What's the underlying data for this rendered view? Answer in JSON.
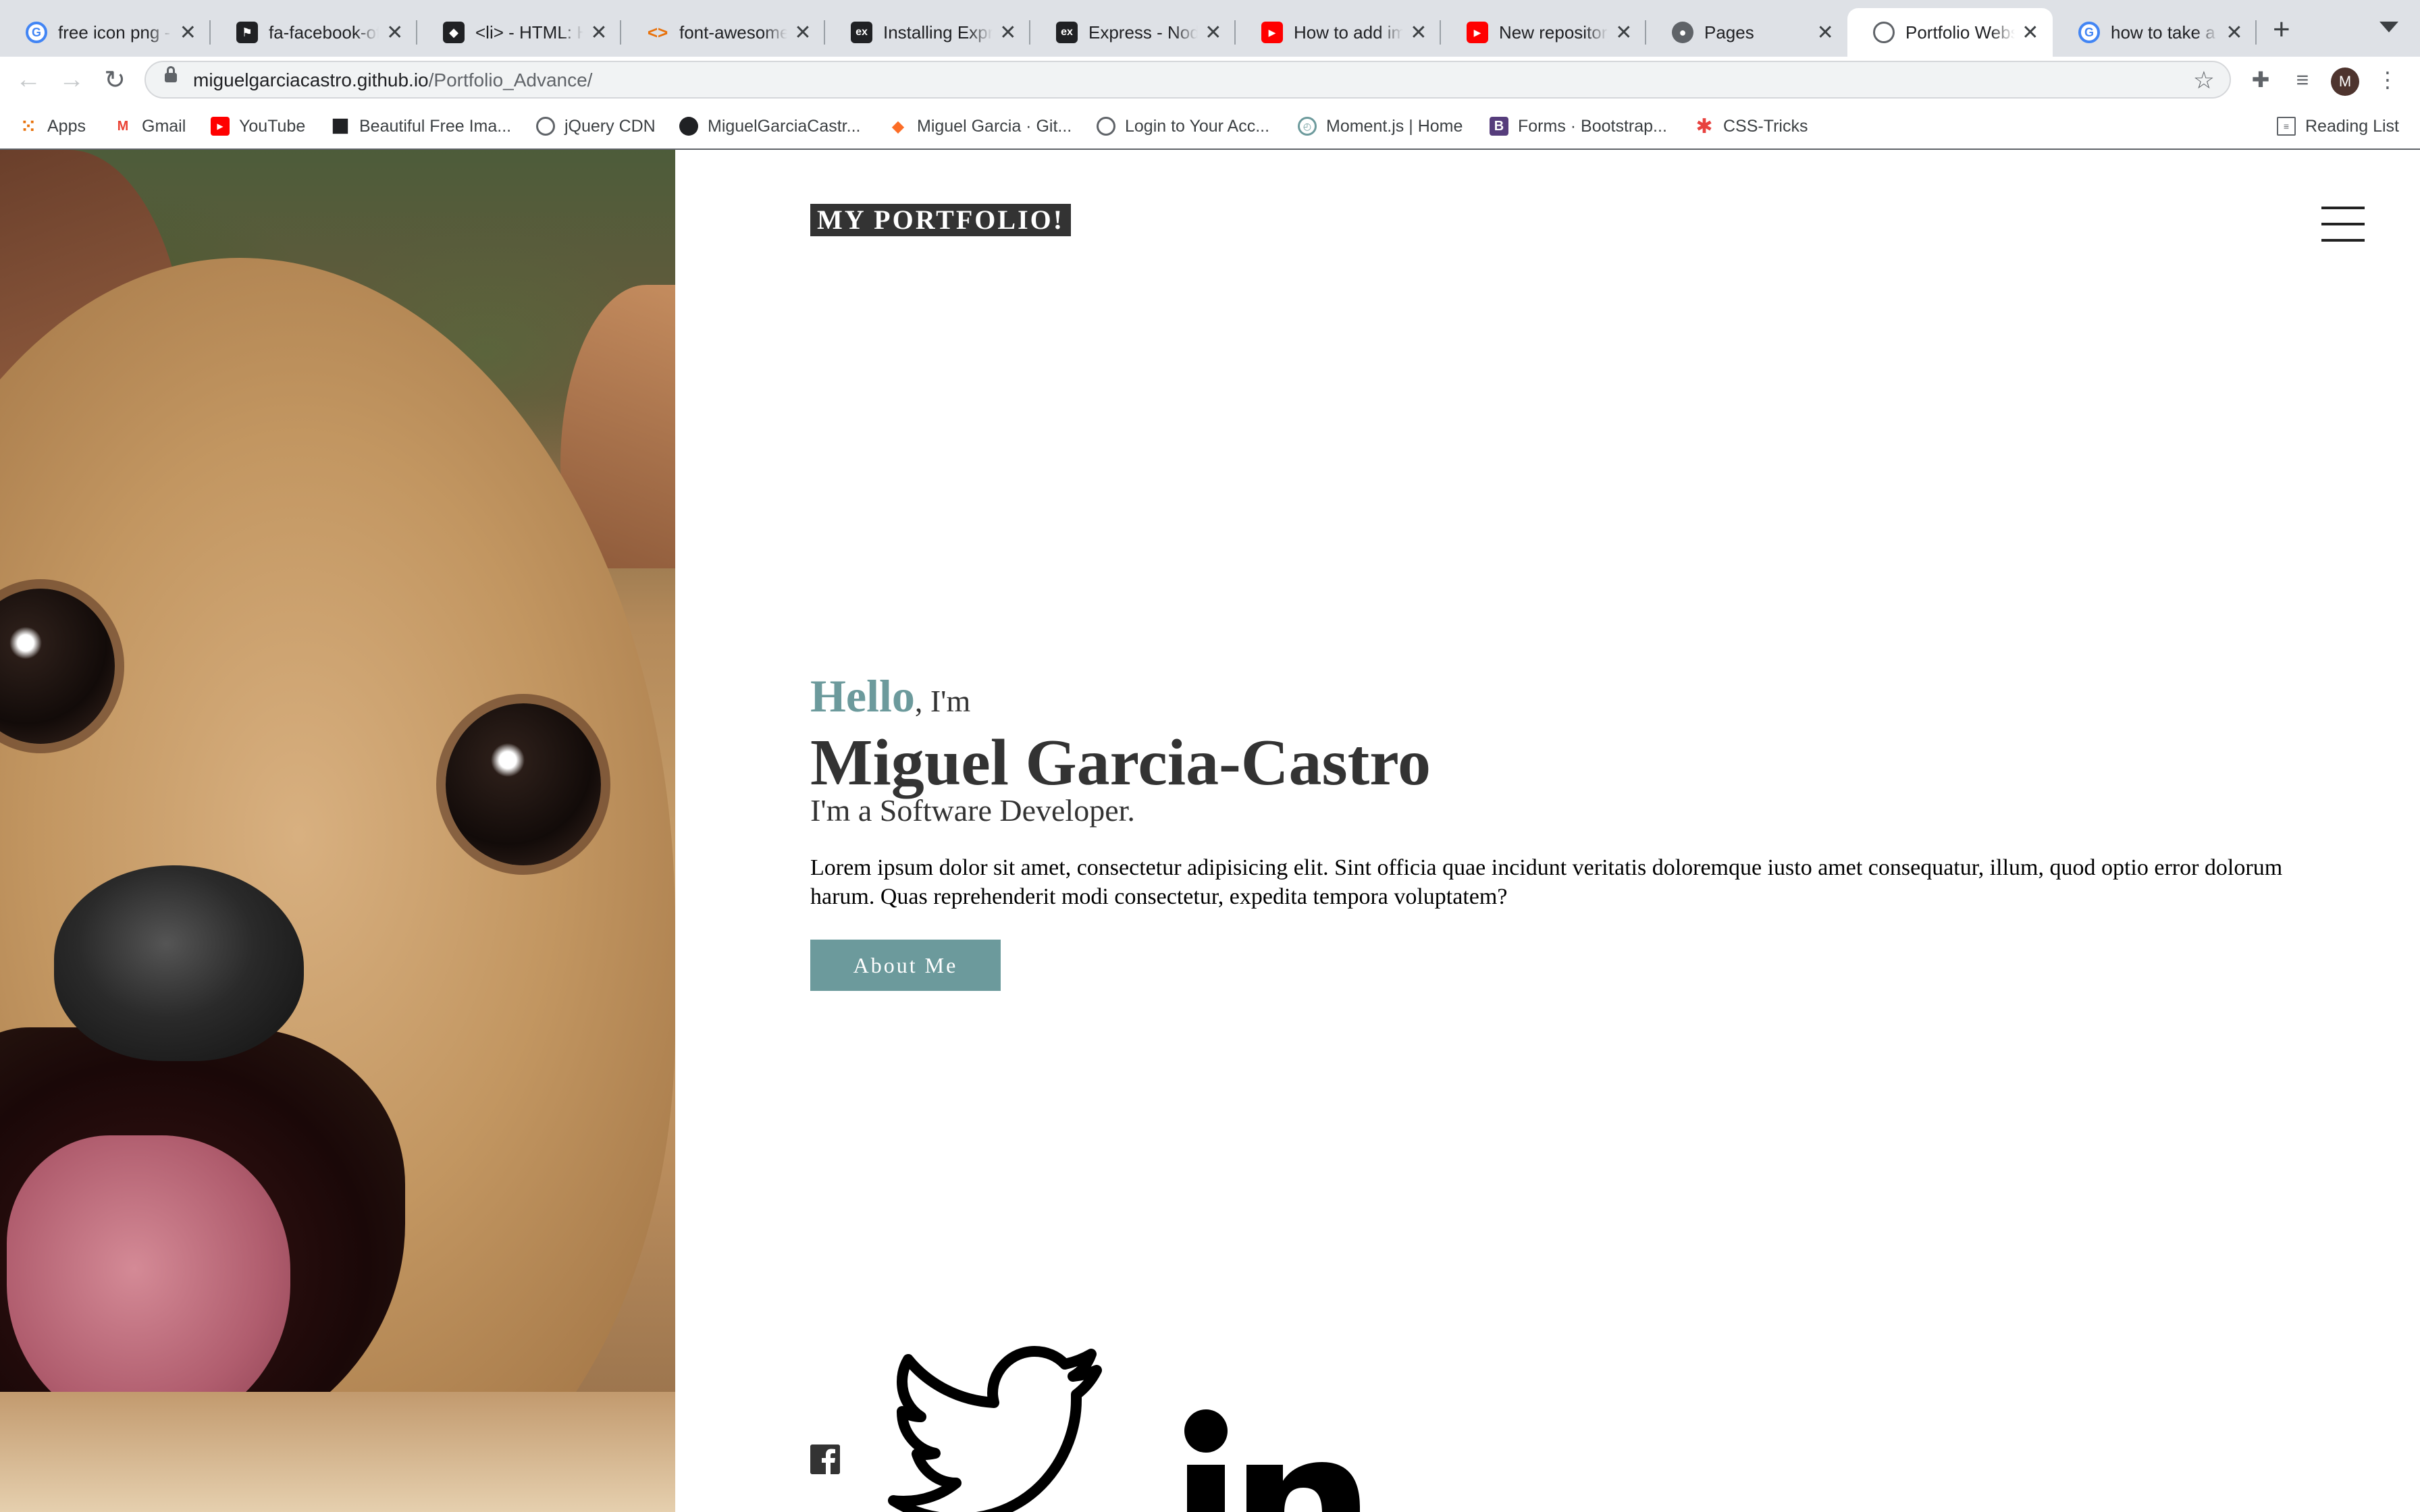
{
  "browser": {
    "tabs": [
      {
        "label": "free icon png -",
        "icon": "google-icon",
        "color": "#4285f4"
      },
      {
        "label": "fa-facebook-of",
        "icon": "flag-icon",
        "color": "#202124"
      },
      {
        "label": "<li> - HTML: H",
        "icon": "mdn-icon",
        "color": "#202124"
      },
      {
        "label": "font-awesome",
        "icon": "code-icon",
        "color": "#e8710a"
      },
      {
        "label": "Installing Expre",
        "icon": "express-icon",
        "color": "#202124"
      },
      {
        "label": "Express - Node",
        "icon": "express-icon",
        "color": "#202124"
      },
      {
        "label": "How to add ima",
        "icon": "youtube-icon",
        "color": "#ff0000"
      },
      {
        "label": "New repository",
        "icon": "youtube-icon",
        "color": "#ff0000"
      },
      {
        "label": "Pages",
        "icon": "github-icon",
        "color": "#5f6368"
      },
      {
        "label": "Portfolio Websi",
        "icon": "globe-icon",
        "color": "#5f6368",
        "active": true
      },
      {
        "label": "how to take a s",
        "icon": "google-icon",
        "color": "#4285f4"
      }
    ],
    "close_glyph": "✕",
    "new_tab_glyph": "+",
    "url_host": "miguelgarciacastro.github.io",
    "url_path": "/Portfolio_Advance/",
    "avatar_letter": "M",
    "bookmarks": [
      {
        "label": "Apps",
        "icon": "apps-grid-icon"
      },
      {
        "label": "Gmail",
        "icon": "gmail-icon"
      },
      {
        "label": "YouTube",
        "icon": "youtube-icon"
      },
      {
        "label": "Beautiful Free Ima...",
        "icon": "unsplash-icon"
      },
      {
        "label": "jQuery CDN",
        "icon": "globe-icon"
      },
      {
        "label": "MiguelGarciaCastr...",
        "icon": "github-icon"
      },
      {
        "label": "Miguel Garcia · Git...",
        "icon": "gitlab-icon"
      },
      {
        "label": "Login to Your Acc...",
        "icon": "globe-icon"
      },
      {
        "label": "Moment.js | Home",
        "icon": "clock-icon"
      },
      {
        "label": "Forms · Bootstrap...",
        "icon": "bootstrap-icon"
      },
      {
        "label": "CSS-Tricks",
        "icon": "asterisk-icon"
      }
    ],
    "reading_list": "Reading List"
  },
  "page": {
    "brand": "MY PORTFOLIO!",
    "hello_word": "Hello",
    "hello_rest": ", I'm",
    "name": "Miguel Garcia-Castro",
    "subtitle": "I'm a Software Developer.",
    "intro": "Lorem ipsum dolor sit amet, consectetur adipisicing elit. Sint officia quae incidunt veritatis doloremque iusto amet consequatur, illum, quod optio error dolorum harum. Quas reprehenderit modi consectetur, expedita tempora voluptatem?",
    "about_button": "About Me",
    "social": [
      "facebook-icon",
      "twitter-icon",
      "linkedin-icon"
    ],
    "colors": {
      "accent": "#6c9a9c",
      "text": "#333333",
      "brand_bg": "#333333"
    }
  }
}
